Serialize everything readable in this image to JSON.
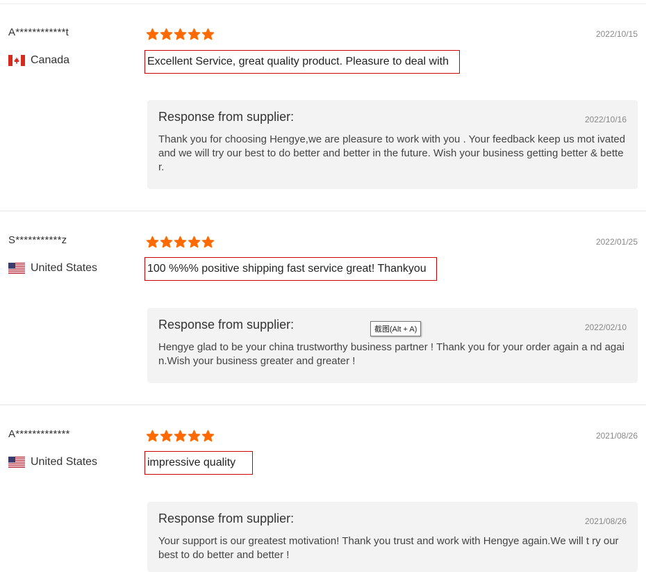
{
  "reviews": [
    {
      "buyer": "A************t",
      "country": "Canada",
      "flag": "canada-flag",
      "rating": 5,
      "date": "2022/10/15",
      "text": "Excellent Service, great quality product. Pleasure to deal with",
      "response": {
        "title": "Response from supplier:",
        "date": "2022/10/16",
        "text": "Thank you for choosing Hengye,we are pleasure to work with you . Your feedback keep us mot ivated and we will try our best to do better and better in the future. Wish your business getting better & better."
      }
    },
    {
      "buyer": "S***********z",
      "country": "United States",
      "flag": "united-states-flag",
      "rating": 5,
      "date": "2022/01/25",
      "text": "100 %%% positive shipping fast service great! Thankyou",
      "response": {
        "title": "Response from supplier:",
        "date": "2022/02/10",
        "text": "Hengye glad to be your china trustworthy business partner ! Thank you for your order again a nd again.Wish your business greater and greater !"
      }
    },
    {
      "buyer": "A*************",
      "country": "United States",
      "flag": "united-states-flag",
      "rating": 5,
      "date": "2021/08/26",
      "text": "impressive quality",
      "response": {
        "title": "Response from supplier:",
        "date": "2021/08/26",
        "text": "Your support is our greatest motivation! Thank you trust and work with Hengye again.We will t ry our best to do better and better !"
      }
    }
  ],
  "tooltip": "截图(Alt + A)",
  "colors": {
    "star": "#ff6a00",
    "highlight_border": "#cc0000",
    "response_bg": "#f3f3f3"
  }
}
